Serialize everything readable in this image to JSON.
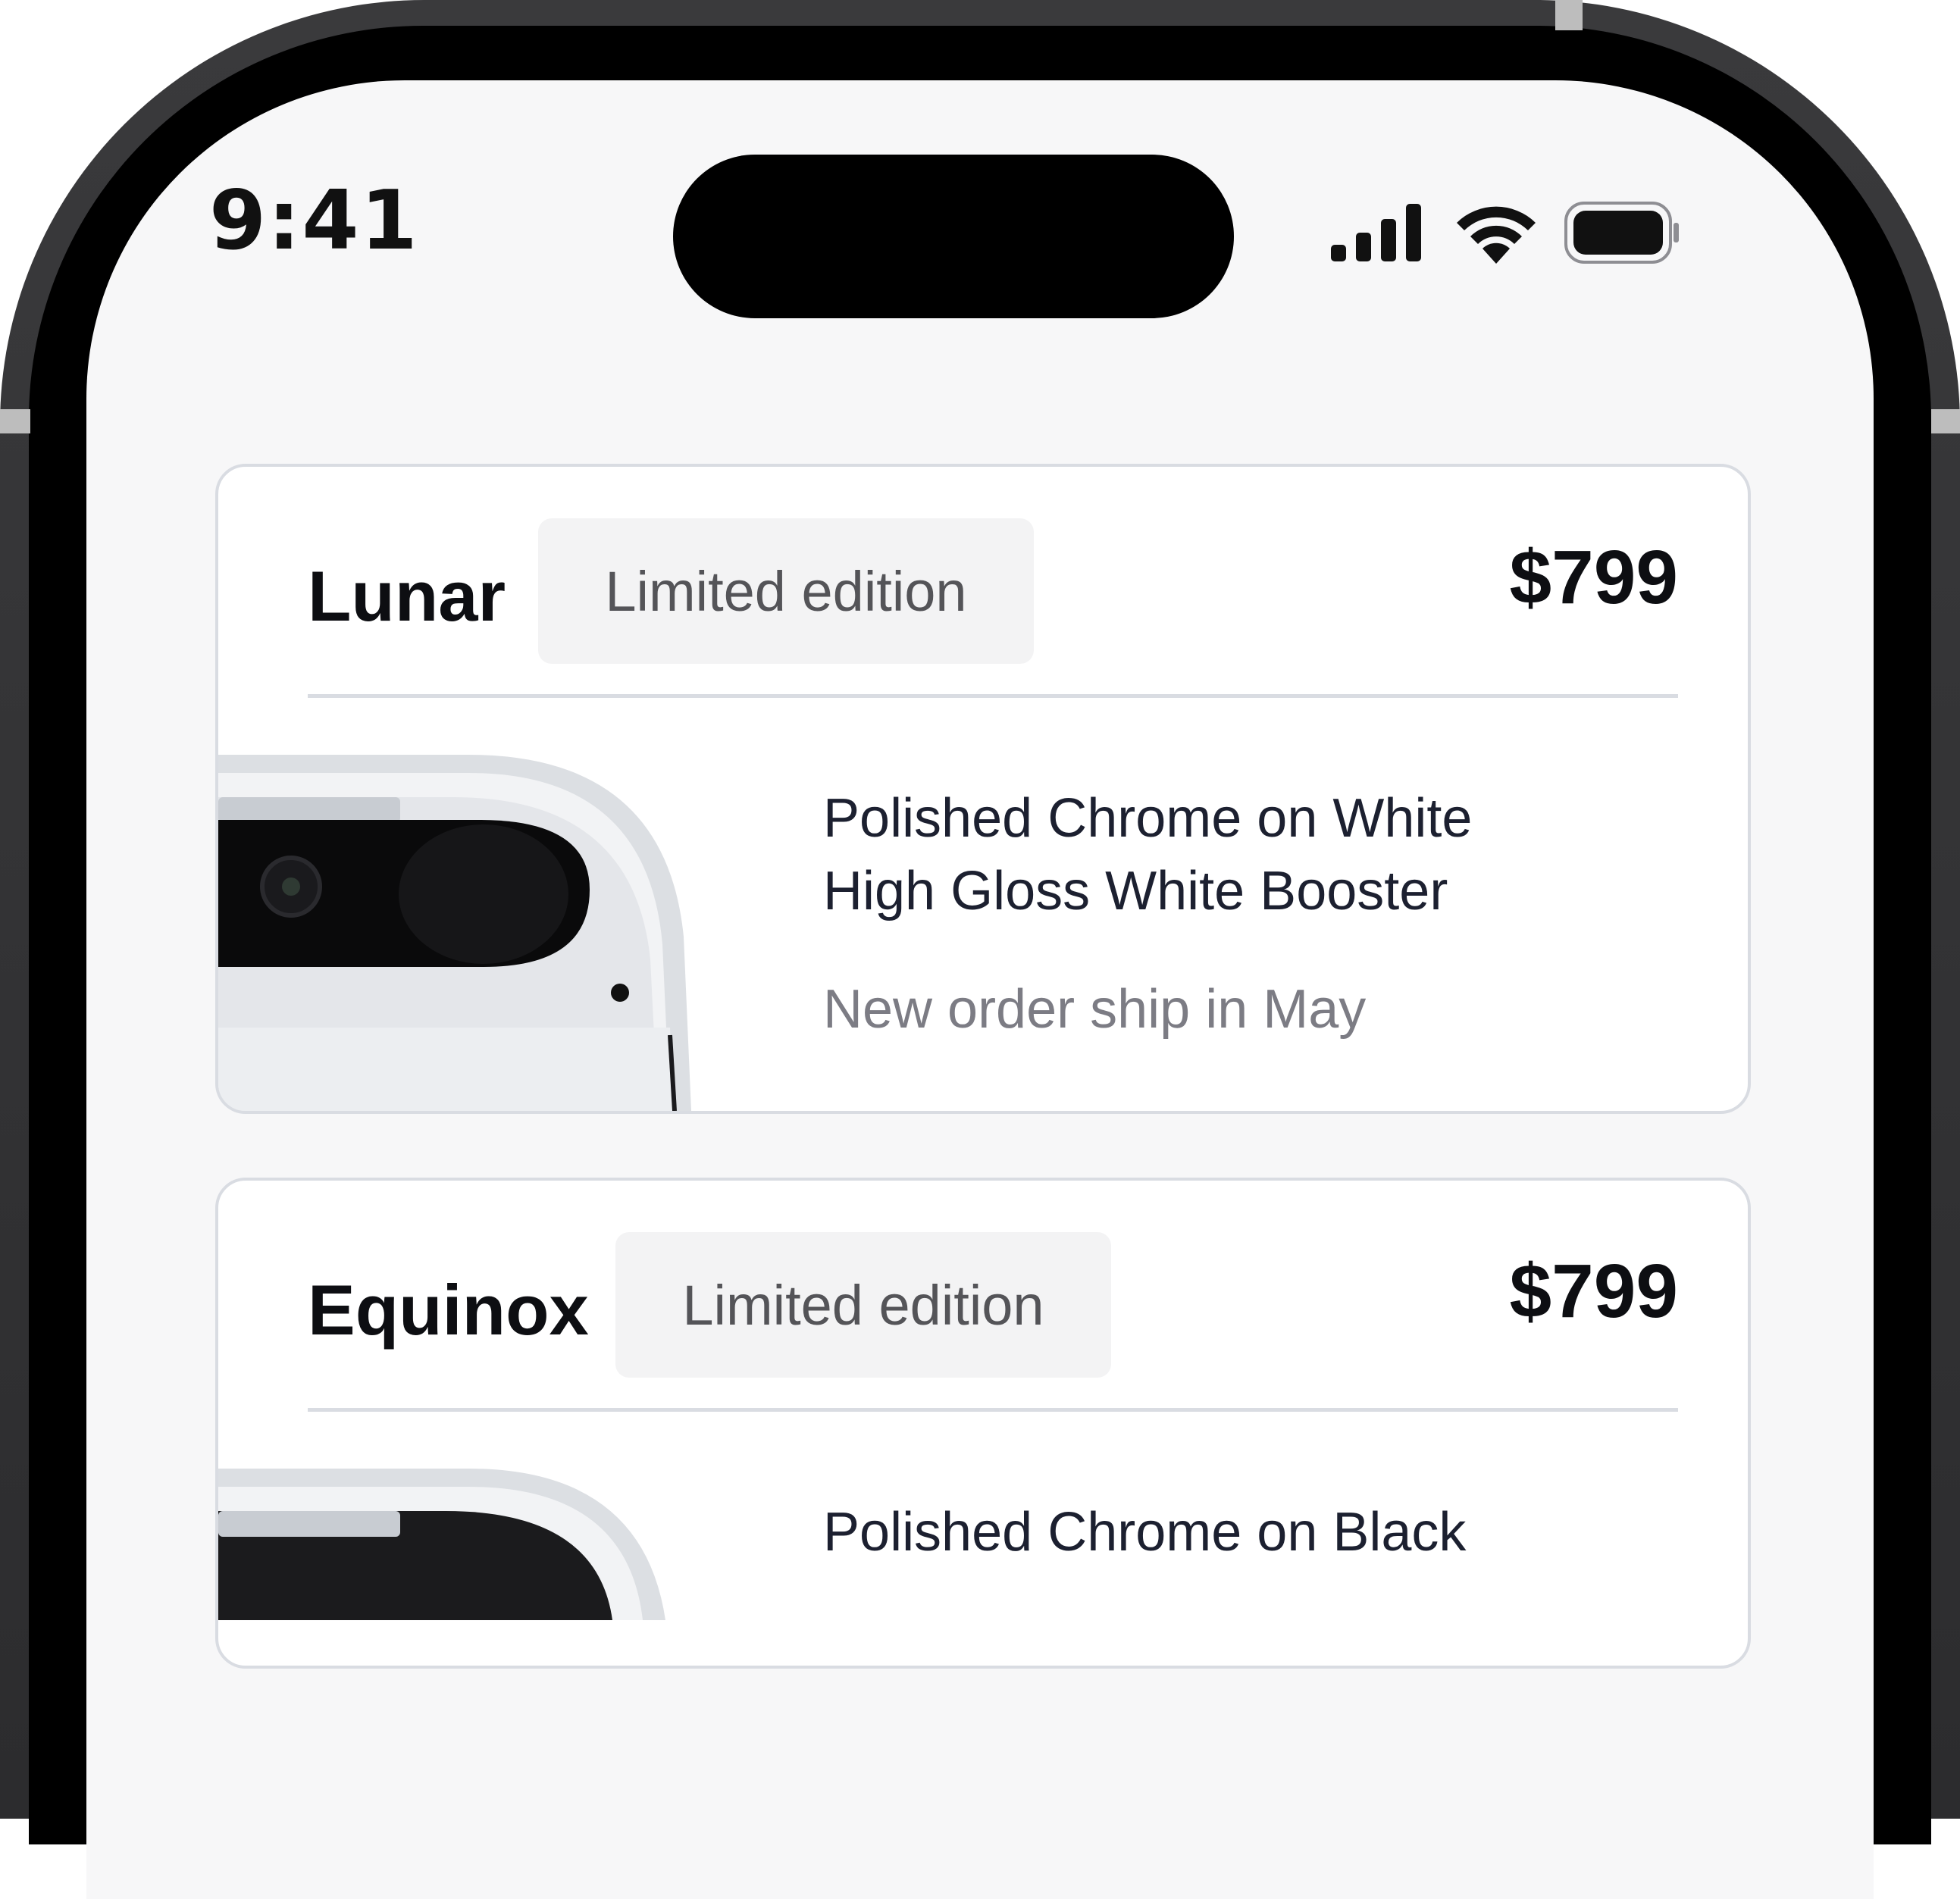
{
  "status_bar": {
    "time": "9:41",
    "icons": [
      "cellular-signal-icon",
      "wifi-icon",
      "battery-icon"
    ]
  },
  "colors": {
    "screen_background": "#f7f7f8",
    "card_border": "#d9dce2",
    "badge_background": "#f3f3f4",
    "text_primary": "#0d0e12",
    "text_secondary": "#7c7c84"
  },
  "products": [
    {
      "name": "Lunar",
      "badge": "Limited edition",
      "price": "$799",
      "variant_line_1": "Polished Chrome on White",
      "variant_line_2": "High Gloss White Booster",
      "shipping_note": "New order ship in May"
    },
    {
      "name": "Equinox",
      "badge": "Limited edition",
      "price": "$799",
      "variant_line_1": "Polished Chrome on Black"
    }
  ]
}
